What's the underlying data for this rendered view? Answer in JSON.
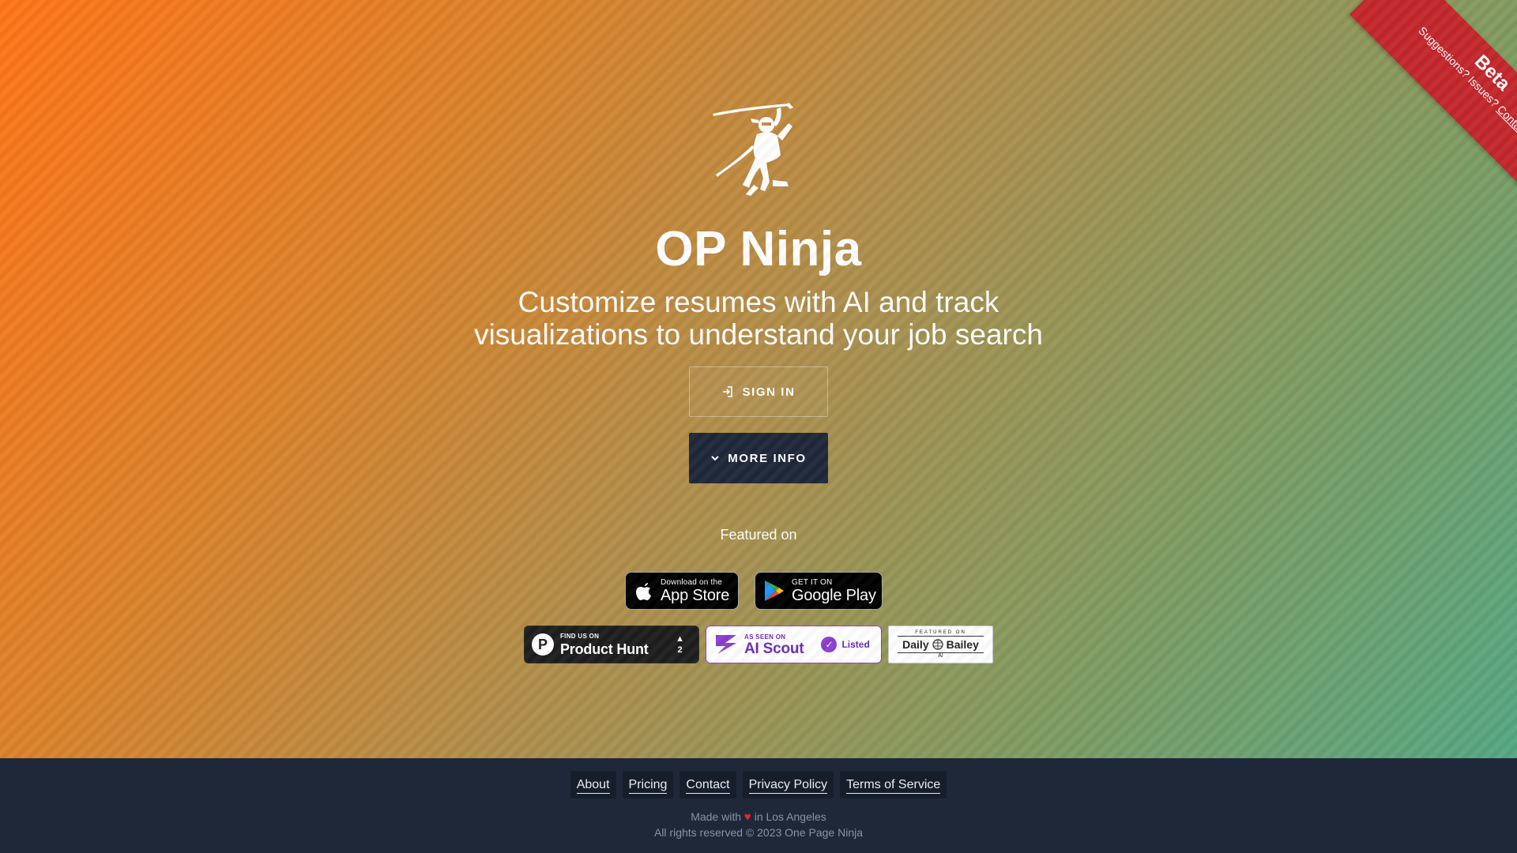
{
  "hero": {
    "title": "OP Ninja",
    "subtitle_line1": "Customize resumes with AI and track",
    "subtitle_line2": "visualizations to understand your job search",
    "logo_icon": "ninja-with-sword-icon"
  },
  "buttons": {
    "sign_in_label": "SIGN IN",
    "sign_in_icon": "login-arrow-icon",
    "more_info_label": "MORE INFO",
    "more_info_icon": "chevron-down-icon"
  },
  "featured": {
    "heading": "Featured on",
    "app_store": {
      "small": "Download on the",
      "big": "App Store"
    },
    "google_play": {
      "small": "GET IT ON",
      "big": "Google Play"
    },
    "product_hunt": {
      "small": "FIND US ON",
      "big": "Product Hunt",
      "votes": "2"
    },
    "ai_scout": {
      "small": "AS SEEN ON",
      "big": "AI Scout",
      "listed": "Listed"
    },
    "daily_bailey": {
      "small": "FEATURED ON",
      "name_left": "Daily",
      "name_right": "Bailey",
      "ai": "AI"
    }
  },
  "ribbon": {
    "beta": "Beta",
    "suggestions": "Suggestions? Issues?",
    "contact": "Contact us"
  },
  "footer": {
    "links": [
      "About",
      "Pricing",
      "Contact",
      "Privacy Policy",
      "Terms of Service"
    ],
    "made_with_prefix": "Made with",
    "made_with_suffix": "in Los Angeles",
    "rights": "All rights reserved © 2023 One Page Ninja"
  },
  "colors": {
    "gradient_start": "#ff7518",
    "gradient_end": "#55a783",
    "dark_navy": "#1e2839",
    "ribbon_red": "#c3272b"
  }
}
